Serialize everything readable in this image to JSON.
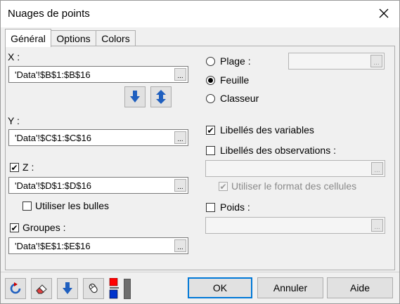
{
  "window": {
    "title": "Nuages de points"
  },
  "tabs": [
    {
      "label": "Général"
    },
    {
      "label": "Options"
    },
    {
      "label": "Colors"
    }
  ],
  "x_section": {
    "label": "X :",
    "value": "'Data'!$B$1:$B$16"
  },
  "y_section": {
    "label": "Y :",
    "value": "'Data'!$C$1:$C$16"
  },
  "z_section": {
    "label": "Z :",
    "checked": true,
    "value": "'Data'!$D$1:$D$16"
  },
  "bubbles": {
    "label": "Utiliser les bulles",
    "checked": false
  },
  "groups": {
    "label": "Groupes :",
    "checked": true,
    "value": "'Data'!$E$1:$E$16"
  },
  "range_options": {
    "plage": "Plage :",
    "feuille": "Feuille",
    "classeur": "Classeur",
    "selected": "Feuille",
    "plage_value": ""
  },
  "var_labels": {
    "label": "Libellés des variables",
    "checked": true
  },
  "obs_labels": {
    "label": "Libellés des observations :",
    "checked": false,
    "value": ""
  },
  "cell_format": {
    "label": "Utiliser le format des cellules",
    "checked": true,
    "disabled": true
  },
  "weights": {
    "label": "Poids :",
    "checked": false,
    "value": ""
  },
  "dots": "...",
  "icons": {
    "close": "close-icon",
    "arrow_down": "arrow-down-icon",
    "arrow_updown": "swap-vertical-icon",
    "reset": "reset-icon",
    "eraser": "eraser-icon",
    "download": "download-icon",
    "mouse": "mouse-icon",
    "color_switch": "color-switch-icon"
  },
  "colors": {
    "accent_blue": "#1f5fbf",
    "red": "#ff0000",
    "blue": "#0033cc",
    "default_border": "#0078d7"
  },
  "footer": {
    "ok": "OK",
    "cancel": "Annuler",
    "help": "Aide"
  }
}
